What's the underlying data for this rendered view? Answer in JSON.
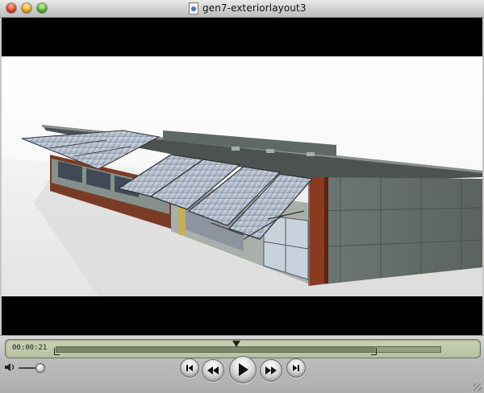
{
  "window": {
    "title": "gen7-exteriorlayout3",
    "document_icon": "quicktime-document-icon"
  },
  "video": {
    "content": "3D rendering of a building with solar panel awnings"
  },
  "controls": {
    "timecode": "00:00:21",
    "playback_progress": 0.47,
    "selection_start": 0.0,
    "selection_end": 0.83,
    "volume_level": 0.85,
    "icons": {
      "volume": "speaker-icon",
      "go_to_start": "skip-to-start-icon",
      "rewind": "rewind-icon",
      "play": "play-icon",
      "fast_forward": "fast-forward-icon",
      "go_to_end": "skip-to-end-icon"
    }
  },
  "colors": {
    "close": "#e0442c",
    "minimize": "#f2b21c",
    "zoom": "#5dbb2d",
    "lcd": "#c3caac"
  }
}
